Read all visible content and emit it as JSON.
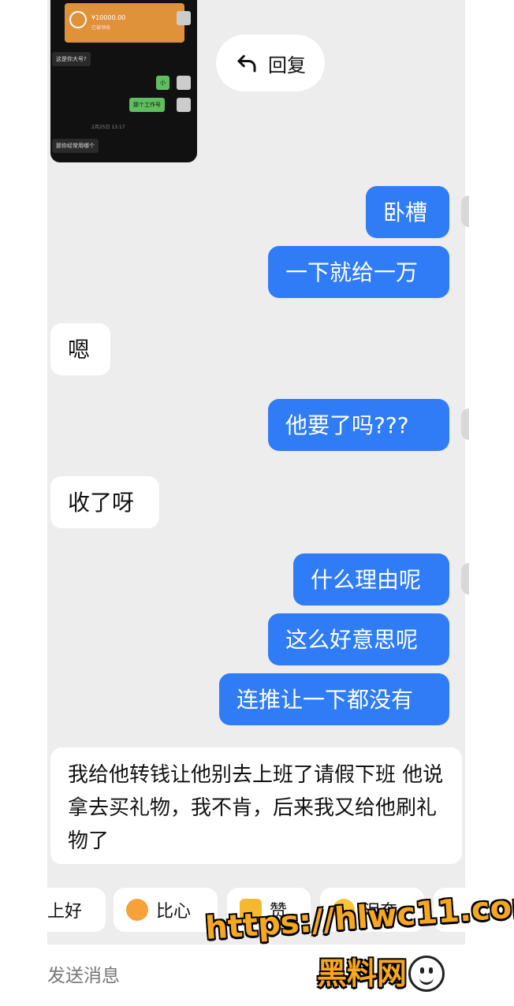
{
  "embedded_screenshot": {
    "amount": "¥10000.00",
    "amount_sub": "已被领收",
    "messages": [
      "这是你大号?",
      "小",
      "那个工作号",
      "那你经常用哪个"
    ],
    "date": "2月25日 13:17"
  },
  "reply_button": {
    "label": "回复",
    "icon": "reply-arrow-icon"
  },
  "messages": [
    {
      "side": "out",
      "text": "卧槽"
    },
    {
      "side": "out",
      "text": "一下就给一万"
    },
    {
      "side": "in",
      "text": "嗯"
    },
    {
      "side": "out",
      "text": "他要了吗???"
    },
    {
      "side": "in",
      "text": "收了呀"
    },
    {
      "side": "out",
      "text": "什么理由呢"
    },
    {
      "side": "out",
      "text": "这么好意思呢"
    },
    {
      "side": "out",
      "text": "连推让一下都没有"
    },
    {
      "side": "in",
      "text": "我给他转钱让他别去上班了请假下班 他说拿去买礼物，我不肯，后来我又给他刷礼物了"
    }
  ],
  "quick_reactions": [
    {
      "label": "上好",
      "icon": "none"
    },
    {
      "label": "比心",
      "icon": "heart-hands-icon"
    },
    {
      "label": "赞",
      "icon": "thumbs-up-icon"
    },
    {
      "label": "泪奔",
      "icon": "crying-face-icon"
    }
  ],
  "input": {
    "placeholder": "发送消息",
    "emoji_icon": "smiley-icon"
  },
  "watermark": {
    "line1": "https://hlwc11.com",
    "line2": "黑料网"
  },
  "colors": {
    "outgoing_bubble": "#2f7cf6",
    "incoming_bubble": "#ffffff",
    "background": "#ededed"
  }
}
